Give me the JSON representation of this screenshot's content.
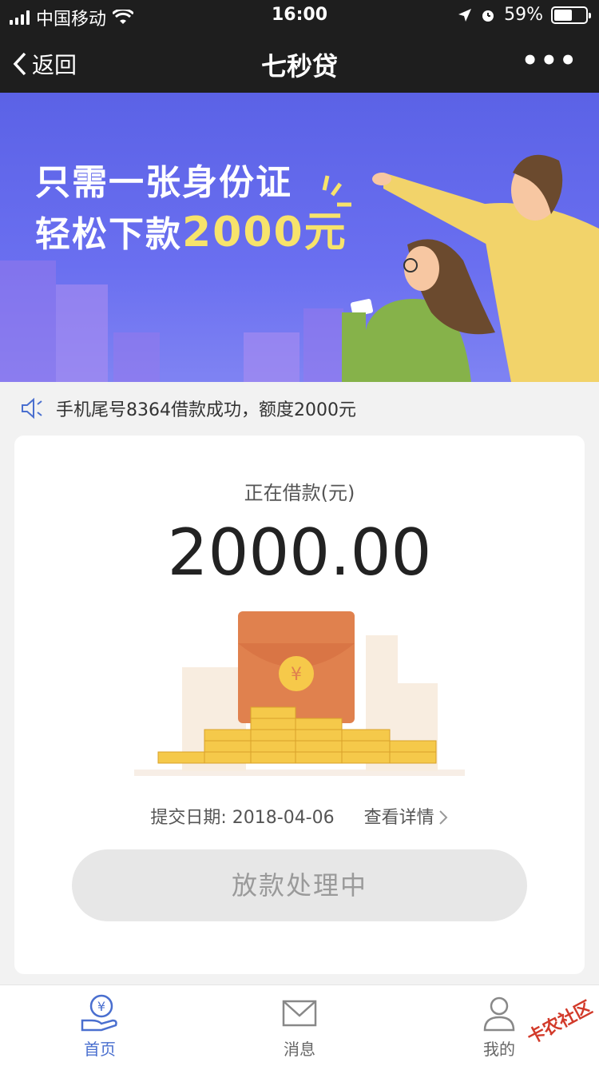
{
  "status_bar": {
    "carrier": "中国移动",
    "time": "16:00",
    "battery": "59%"
  },
  "nav": {
    "back_label": "返回",
    "title": "七秒贷",
    "more_label": "•••"
  },
  "banner": {
    "line1": "只需一张身份证",
    "line2_prefix": "轻松下款",
    "line2_amount": "2000元"
  },
  "notice": {
    "text": "手机尾号8364借款成功，额度2000元"
  },
  "loan_card": {
    "label": "正在借款(元)",
    "amount": "2000.00",
    "date_label": "提交日期: 2018-04-06",
    "detail_link": "查看详情",
    "status_button": "放款处理中"
  },
  "tabbar": {
    "items": [
      {
        "label": "首页",
        "icon": "home-yen-icon",
        "active": true
      },
      {
        "label": "消息",
        "icon": "mail-icon",
        "active": false
      },
      {
        "label": "我的",
        "icon": "user-icon",
        "active": false
      }
    ]
  },
  "watermark": "卡农社区",
  "colors": {
    "nav_bg": "#1e1e1e",
    "banner_bg": "#5b62e6",
    "highlight": "#f7e36b",
    "tab_active": "#4a6fcf",
    "button_bg": "#e7e7e7"
  }
}
